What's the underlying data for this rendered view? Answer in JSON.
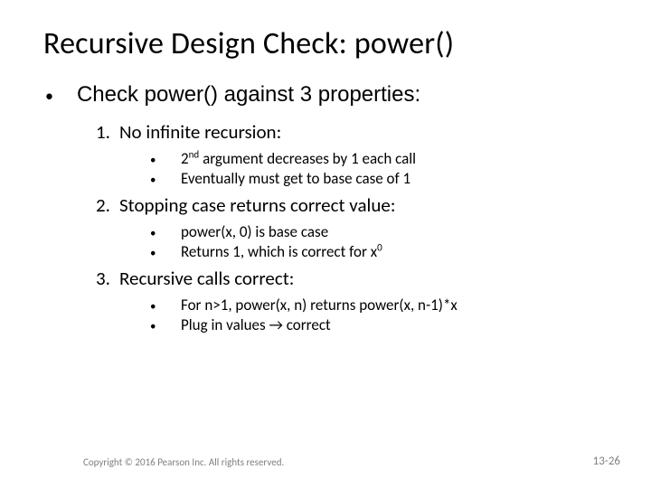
{
  "title": "Recursive Design Check: power()",
  "main_bullet": "Check power() against 3 properties:",
  "items": [
    {
      "num": "1.",
      "label": "No infinite recursion:",
      "subs": [
        {
          "html": "2<sup>nd</sup> argument decreases by 1 each call"
        },
        {
          "text": "Eventually must get to base case of 1"
        }
      ]
    },
    {
      "num": "2.",
      "label": "Stopping case returns correct value:",
      "subs": [
        {
          "text": "power(x, 0) is base case"
        },
        {
          "html": "Returns 1, which is correct for x<sup>0</sup>"
        }
      ]
    },
    {
      "num": "3.",
      "label": "Recursive calls correct:",
      "subs": [
        {
          "text": "For n>1, power(x, n) returns power(x, n-1)*x"
        },
        {
          "text": "Plug in values → correct"
        }
      ]
    }
  ],
  "footer_left": "Copyright © 2016 Pearson Inc. All rights reserved.",
  "footer_right": "13-26"
}
